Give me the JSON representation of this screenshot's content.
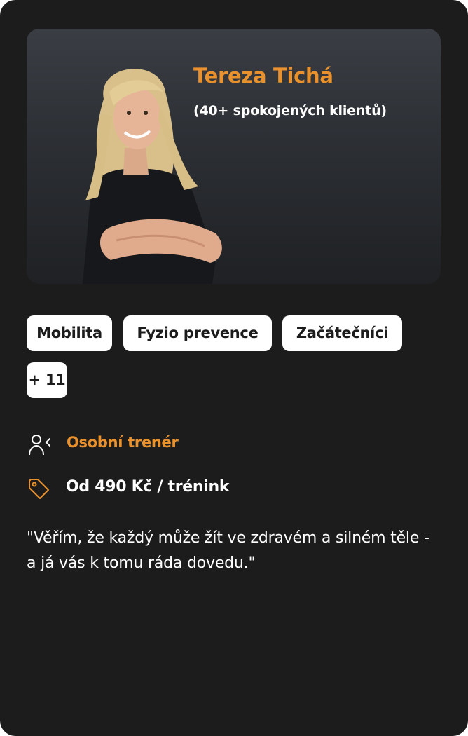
{
  "trainer": {
    "name": "Tereza Tichá",
    "clients": "(40+ spokojených klientů)",
    "photo_alt": "Trainer portrait"
  },
  "tags": [
    "Mobilita",
    "Fyzio prevence",
    "Začátečníci"
  ],
  "more_tags": "+ 11",
  "role": {
    "icon": "user-icon",
    "label": "Osobní trenér"
  },
  "price": {
    "icon": "price-tag-icon",
    "label": "Od 490 Kč / trénink"
  },
  "quote": "\"Věřím, že každý může žít ve zdravém a silném těle - a já vás k tomu ráda dovedu.\"",
  "colors": {
    "card_bg": "#1c1c1c",
    "accent": "#e8912d",
    "tag_bg": "#ffffff",
    "text": "#ffffff"
  }
}
